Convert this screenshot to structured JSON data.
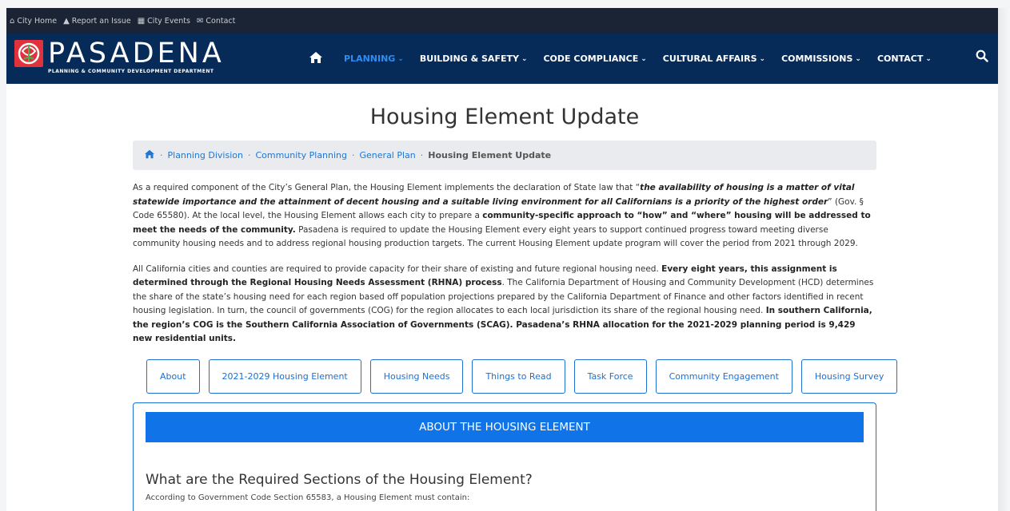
{
  "utility_bar": {
    "links": [
      {
        "icon": "home-icon",
        "glyph": "⌂",
        "label": "City Home"
      },
      {
        "icon": "warning-icon",
        "glyph": "▲",
        "label": "Report an Issue"
      },
      {
        "icon": "calendar-icon",
        "glyph": "▦",
        "label": "City Events"
      },
      {
        "icon": "envelope-icon",
        "glyph": "✉",
        "label": "Contact"
      }
    ]
  },
  "header": {
    "logo_text": "PASADENA",
    "logo_sub": "PLANNING & COMMUNITY DEVELOPMENT DEPARTMENT",
    "nav": [
      {
        "label": "PLANNING",
        "active": true
      },
      {
        "label": "BUILDING & SAFETY",
        "active": false
      },
      {
        "label": "CODE COMPLIANCE",
        "active": false
      },
      {
        "label": "CULTURAL AFFAIRS",
        "active": false
      },
      {
        "label": "COMMISSIONS",
        "active": false
      },
      {
        "label": "CONTACT",
        "active": false
      }
    ],
    "colors": {
      "utility_bg": "#1b2434",
      "nav_bg": "#062b59",
      "active": "#2f8cf0",
      "logo_red": "#e0323b"
    }
  },
  "page": {
    "title": "Housing Element Update",
    "breadcrumb": [
      "Planning Division",
      "Community Planning",
      "General Plan"
    ],
    "breadcrumb_current": "Housing Element Update"
  },
  "para1": {
    "t1": "As a required component of the City’s General Plan, the Housing Element implements the declaration of State law that “",
    "b1": "the availability of housing is a matter of vital statewide importance and the attainment of decent housing and a suitable living environment for all Californians is a priority of the highest order",
    "t2": "” (Gov. § Code 65580). At the local level, the Housing Element allows each city to prepare a ",
    "b2": "community-specific approach to “how” and “where” housing will be addressed to meet the needs of the community.",
    "t3": " Pasadena is required to update the Housing Element every eight years to support continued progress toward meeting diverse community housing needs and to address regional housing production targets. The current Housing Element update program will cover the period from 2021 through 2029."
  },
  "para2": {
    "t1": "All California cities and counties are required to provide capacity for their share of existing and future regional housing need. ",
    "b1": "Every eight years, this assignment is determined through the Regional Housing Needs Assessment (RHNA) process",
    "t2": ". The California Department of Housing and Community Development (HCD) determines the share of the state’s housing need for each region based off population projections prepared by the California Department of Finance and other factors identified in recent housing legislation. In turn, the council of governments (COG) for the region allocates to each local jurisdiction its share of the regional housing need. ",
    "b2": "In southern California, the region’s COG is the Southern California Association of Governments (SCAG). Pasadena’s RHNA allocation for the 2021-2029 planning period is 9,429 new residential units."
  },
  "tabs": [
    "About",
    "2021-2029 Housing Element",
    "Housing Needs",
    "Things to Read",
    "Task Force",
    "Community Engagement",
    "Housing Survey"
  ],
  "panel": {
    "heading": "ABOUT THE HOUSING ELEMENT",
    "question": "What are the Required Sections of the Housing Element?",
    "text": "According to Government Code Section 65583, a Housing Element must contain:"
  }
}
